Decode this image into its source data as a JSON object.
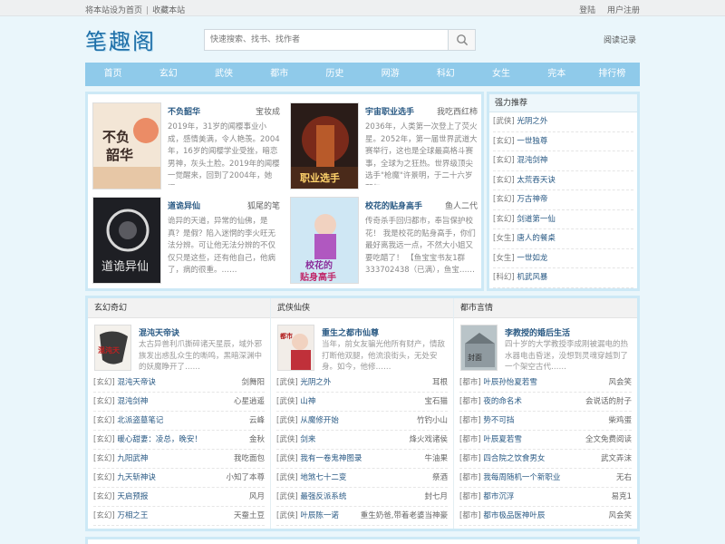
{
  "topbar": {
    "set_home": "将本站设为首页",
    "separator": "|",
    "bookmark": "收藏本站",
    "login": "登陆",
    "register": "用户注册"
  },
  "header": {
    "logo": "笔趣阁",
    "search_placeholder": "快速搜索、找书、找作者",
    "search_icon": "search-icon",
    "read_log": "阅读记录"
  },
  "nav": [
    "首页",
    "玄幻",
    "武侠",
    "都市",
    "历史",
    "网游",
    "科幻",
    "女生",
    "完本",
    "排行榜"
  ],
  "featured": [
    {
      "title": "不负韶华",
      "author": "宝妆成",
      "desc": "2019年，31岁的闻樱事业小成，感情美满，令人艳羡。2004年，16岁的闻樱学业受挫，暗恋男神，灰头土脸。2019年的闻樱一觉醒来，回到了2004年，她还……",
      "cover_text": "不负韶华"
    },
    {
      "title": "宇宙职业选手",
      "author": "我吃西红柿",
      "desc": "2036年，人类第一次登上了荧火星。2052年，第一届世界武道大赛举行，这也是全球最高格斗赛事，全球为之狂热。世界级顶尖选手\"枪魔\"许景明，于二十六岁那年，……",
      "cover_text": "宇宙职业选手"
    },
    {
      "title": "道诡异仙",
      "author": "狐尾的笔",
      "desc": "诡异的天道，异常的仙佛，是真？是假？陷入迷惘的李火旺无法分辨。可让他无法分辨的不仅仅只是这些，还有他自己，他病了，病的很重。……",
      "cover_text": "道诡异仙"
    },
    {
      "title": "校花的贴身高手",
      "author": "鱼人二代",
      "desc": "传奇杀手回归都市，奉旨保护校花！ 我是校花的贴身高手，你们最好离我远一点，不然大小姐又要吃醋了！ 【鱼宝宝书友1群 333702438（已满），鱼宝……",
      "cover_text": "校花的贴身高手"
    }
  ],
  "sidebar": {
    "title": "强力推荐",
    "items": [
      {
        "cat": "[武侠]",
        "name": "光阴之外"
      },
      {
        "cat": "[玄幻]",
        "name": "一世独尊"
      },
      {
        "cat": "[玄幻]",
        "name": "混沌剑神"
      },
      {
        "cat": "[玄幻]",
        "name": "太荒吞天诀"
      },
      {
        "cat": "[玄幻]",
        "name": "万古神帝"
      },
      {
        "cat": "[玄幻]",
        "name": "剑道第一仙"
      },
      {
        "cat": "[女生]",
        "name": "唐人的餐桌"
      },
      {
        "cat": "[女生]",
        "name": "一世如龙"
      },
      {
        "cat": "[科幻]",
        "name": "机武风暴"
      }
    ]
  },
  "columns": [
    {
      "title": "玄幻奇幻",
      "feat": {
        "title": "混沌天帝诀",
        "desc": "太古异兽利爪撕碎诸天星辰，域外邪族发出惑乱众生的嘶鸣，黑暗深渊中的妖魔睁开了……",
        "cover_text": "混沌天帝诀"
      },
      "rows": [
        {
          "cat": "[玄幻]",
          "name": "混沌天帝诀",
          "author": "剑舞阳"
        },
        {
          "cat": "[玄幻]",
          "name": "混沌剑神",
          "author": "心星逍遥"
        },
        {
          "cat": "[玄幻]",
          "name": "北派盗墓笔记",
          "author": "云峰"
        },
        {
          "cat": "[玄幻]",
          "name": "暖心甜妻：凌总，晚安！",
          "author": "金秋"
        },
        {
          "cat": "[玄幻]",
          "name": "九阳武神",
          "author": "我吃面包"
        },
        {
          "cat": "[玄幻]",
          "name": "九天斩神诀",
          "author": "小知了本尊"
        },
        {
          "cat": "[玄幻]",
          "name": "天启预报",
          "author": "风月"
        },
        {
          "cat": "[玄幻]",
          "name": "万相之王",
          "author": "天蚕土豆"
        }
      ]
    },
    {
      "title": "武侠仙侠",
      "feat": {
        "title": "重生之都市仙尊",
        "desc": "当年，前女友骗光他所有财产，情敌打断他双腿，他流浪街头，无处安身。如今，他修……",
        "cover_text": "都市仙尊"
      },
      "rows": [
        {
          "cat": "[武侠]",
          "name": "光阴之外",
          "author": "耳根"
        },
        {
          "cat": "[武侠]",
          "name": "山神",
          "author": "宝石猫"
        },
        {
          "cat": "[武侠]",
          "name": "从魔修开始",
          "author": "竹钓小山"
        },
        {
          "cat": "[武侠]",
          "name": "剑来",
          "author": "烽火戏诸侯"
        },
        {
          "cat": "[武侠]",
          "name": "我有一卷鬼神图录",
          "author": "牛油果"
        },
        {
          "cat": "[武侠]",
          "name": "地煞七十二变",
          "author": "祭酒"
        },
        {
          "cat": "[武侠]",
          "name": "最强反派系统",
          "author": "封七月"
        },
        {
          "cat": "[武侠]",
          "name": "叶辰陈一诺",
          "author": "重生奶爸,带着老婆当神豪"
        }
      ]
    },
    {
      "title": "都市言情",
      "feat": {
        "title": "李教授的婚后生活",
        "desc": "四十岁的大学教授李成刚被漏电的热水器电击昏迷，没想到灵魂穿越到了一个架空古代……",
        "cover_text": "都市封面"
      },
      "rows": [
        {
          "cat": "[都市]",
          "name": "叶辰孙怡夏若雪",
          "author": "风会笑"
        },
        {
          "cat": "[都市]",
          "name": "夜的命名术",
          "author": "会说话的肘子"
        },
        {
          "cat": "[都市]",
          "name": "势不可挡",
          "author": "柴鸡蛋"
        },
        {
          "cat": "[都市]",
          "name": "叶辰夏若雪",
          "author": "全文免费阅读"
        },
        {
          "cat": "[都市]",
          "name": "四合院之饮食男女",
          "author": "武文弄沫"
        },
        {
          "cat": "[都市]",
          "name": "我每周随机一个新职业",
          "author": "无右"
        },
        {
          "cat": "[都市]",
          "name": "都市沉浮",
          "author": "易克1"
        },
        {
          "cat": "[都市]",
          "name": "都市极品医神叶辰",
          "author": "风会笑"
        }
      ]
    }
  ],
  "colors": {
    "nav_bg": "#8fcaea",
    "panel_border": "#cde9f6",
    "link": "#2a5a84",
    "page_bg": "#eaf6fb"
  }
}
